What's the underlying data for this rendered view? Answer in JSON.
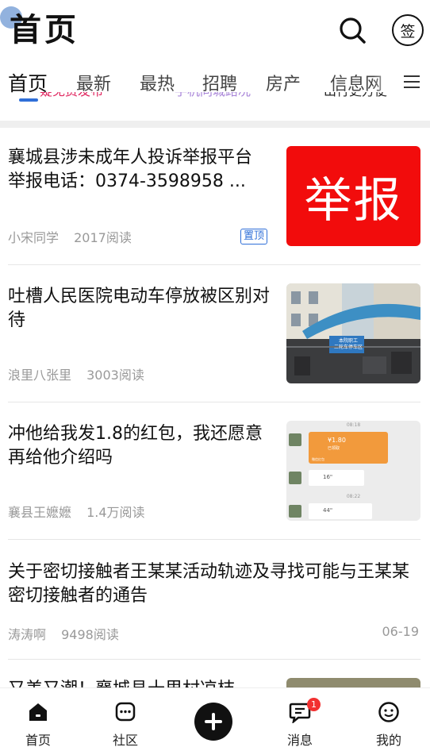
{
  "header": {
    "title": "首页",
    "sign_label": "签"
  },
  "tabs": [
    {
      "label": "首页",
      "active": true
    },
    {
      "label": "最新",
      "active": false
    },
    {
      "label": "最热",
      "active": false
    },
    {
      "label": "招聘",
      "active": false
    },
    {
      "label": "房产",
      "active": false
    },
    {
      "label": "信息网",
      "active": false
    }
  ],
  "ticker": {
    "items": [
      {
        "text": "疑免费发布",
        "color": "#e0245e"
      },
      {
        "text": "手机同城路况",
        "color": "#a884d8"
      },
      {
        "text": "出行更方便",
        "color": "#222222"
      }
    ]
  },
  "articles": [
    {
      "title": "襄城县涉未成年人投诉举报平台\n举报电话：0374-3598958 ...",
      "author": "小宋同学",
      "reads": "2017阅读",
      "pinned_label": "置顶",
      "thumb_text": "举报"
    },
    {
      "title": "吐槽人民医院电动车停放被区别对待",
      "author": "浪里八张里",
      "reads": "3003阅读",
      "thumb_sign": "本院职工\n二轮车停车区"
    },
    {
      "title": "冲他给我发1.8的红包，我还愿意再给他介绍吗",
      "author": "襄县王嬷嬷",
      "reads": "1.4万阅读",
      "chat": {
        "time1": "08:18",
        "redpacket_amount": "¥1.80",
        "redpacket_status": "已领取",
        "redpacket_footer": "微信红包",
        "voice1": "16\"",
        "time2": "08:22",
        "voice2": "44\""
      }
    },
    {
      "title": "关于密切接触者王某某活动轨迹及寻找可能与王某某密切接触者的通告",
      "author": "涛涛啊",
      "reads": "9498阅读",
      "date": "06-19"
    },
    {
      "title": "又美又潮！襄城县十里村凉桔"
    }
  ],
  "bottom_nav": {
    "home": "首页",
    "community": "社区",
    "messages": "消息",
    "messages_badge": "1",
    "me": "我的"
  },
  "colors": {
    "accent": "#2f6fd8",
    "report_red": "#f20c0c",
    "badge": "#f23030"
  }
}
